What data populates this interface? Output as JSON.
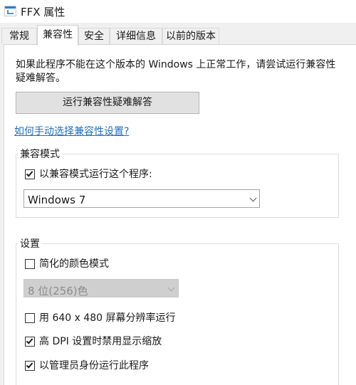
{
  "window": {
    "title": "FFX 属性",
    "icon": "program-shortcut-icon"
  },
  "tabs": [
    {
      "label": "常规",
      "active": false
    },
    {
      "label": "兼容性",
      "active": true
    },
    {
      "label": "安全",
      "active": false
    },
    {
      "label": "详细信息",
      "active": false
    },
    {
      "label": "以前的版本",
      "active": false
    }
  ],
  "compat": {
    "intro": "如果此程序不能在这个版本的 Windows 上正常工作，请尝试运行兼容性疑难解答。",
    "troubleshoot_button": "运行兼容性疑难解答",
    "help_link": "如何手动选择兼容性设置?",
    "mode_group": {
      "label": "兼容模式",
      "checkbox_label": "以兼容模式运行这个程序:",
      "checkbox_checked": true,
      "os_selected": "Windows 7"
    },
    "settings_group": {
      "label": "设置",
      "reduced_color": {
        "label": "简化的颜色模式",
        "checked": false
      },
      "color_selected": "8 位(256)色",
      "res_640": {
        "label": "用 640 x 480 屏幕分辨率运行",
        "checked": false
      },
      "high_dpi": {
        "label": "高 DPI 设置时禁用显示缩放",
        "checked": true
      },
      "run_as_admin": {
        "label": "以管理员身份运行此程序",
        "checked": true
      }
    }
  },
  "colors": {
    "link": "#1f6fc5",
    "panel_bg": "#ffffff",
    "window_bg": "#f0f0f0"
  }
}
